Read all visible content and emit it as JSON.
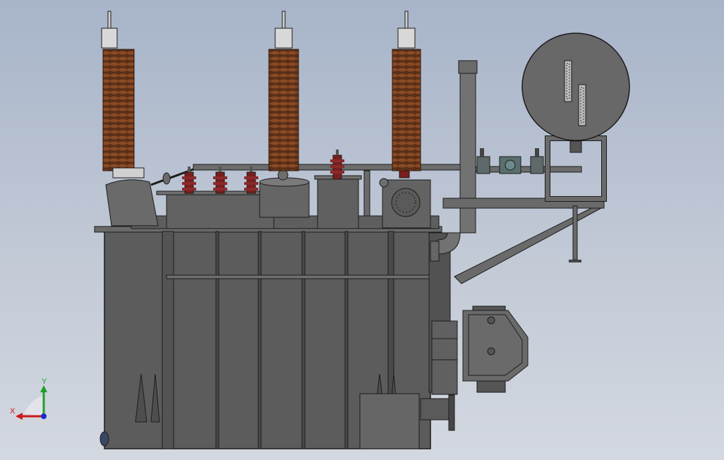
{
  "viewport": {
    "background_top": "#a7b4c9",
    "background_bottom": "#d3d8e0"
  },
  "model": {
    "body_color": "#5b5b5b",
    "edge_color": "#1c1c1c",
    "bushing_color": "#6b3a1e",
    "insulator_red": "#7a1e1e"
  },
  "triad": {
    "x_label": "X",
    "y_label": "Y",
    "x_color": "#cc1a1a",
    "y_color": "#1f9e2a",
    "z_color": "#1a2bcc"
  }
}
